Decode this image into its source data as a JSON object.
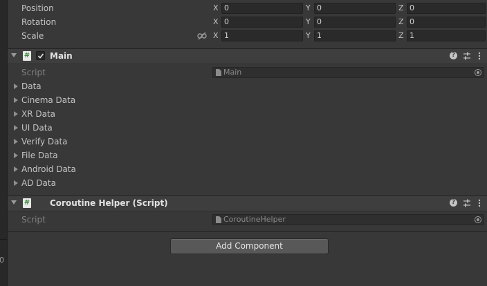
{
  "transform": {
    "rows": [
      {
        "label": "Position",
        "x": "0",
        "y": "0",
        "z": "0"
      },
      {
        "label": "Rotation",
        "x": "0",
        "y": "0",
        "z": "0"
      },
      {
        "label": "Scale",
        "x": "1",
        "y": "1",
        "z": "1"
      }
    ],
    "axes": {
      "x": "X",
      "y": "Y",
      "z": "Z"
    }
  },
  "main": {
    "title": "Main",
    "script_label": "Script",
    "script_value": "Main",
    "fields": [
      "Data",
      "Cinema Data",
      "XR Data",
      "UI Data",
      "Verify Data",
      "File Data",
      "Android Data",
      "AD Data"
    ]
  },
  "coroutine": {
    "title": "Coroutine Helper (Script)",
    "script_label": "Script",
    "script_value": "CoroutineHelper"
  },
  "add_component_label": "Add Component",
  "edge_text": "0",
  "component_icon_glyph": "#",
  "help_glyph": "?",
  "colors": {
    "panel": "#383838",
    "header": "#3e3e3e",
    "field": "#2a2a2a",
    "button": "#585858"
  }
}
